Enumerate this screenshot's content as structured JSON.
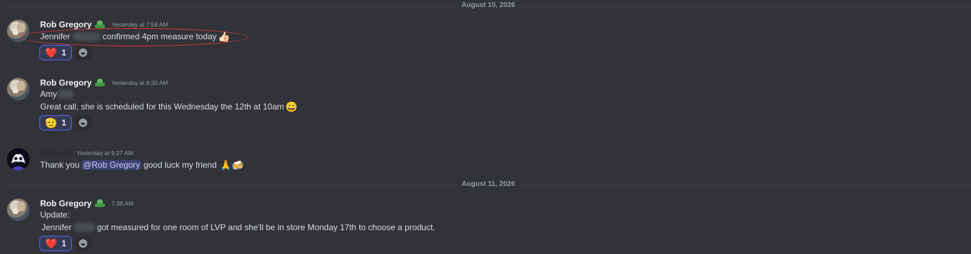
{
  "dividers": [
    "August 10, 2026",
    "August 11, 2026"
  ],
  "messages": [
    {
      "author": "Rob Gregory",
      "time": "Yesterday at 7:58 AM",
      "lines": [
        {
          "pre": "Jennifer",
          "post": "confirmed 4pm measure today",
          "emoji": "👍🏻"
        }
      ],
      "reaction": {
        "emoji": "❤️",
        "count": "1"
      }
    },
    {
      "author": "Rob Gregory",
      "time": "Yesterday at 8:30 AM",
      "lines": [
        {
          "pre": "Amy"
        },
        {
          "text": "Great call, she is scheduled for this Wednesday the 12th at 10am",
          "emoji": "😀"
        }
      ],
      "reaction": {
        "emoji": "🫡",
        "count": "1"
      }
    },
    {
      "author": "Soroush",
      "time": "Yesterday at 9:37 AM",
      "lines": [
        {
          "pre": "Thank you",
          "mention": "@Rob Gregory",
          "post": "good luck my friend",
          "emoji": "🙏🍻"
        }
      ]
    },
    {
      "author": "Rob Gregory",
      "time": "7:38 AM",
      "lines": [
        {
          "text": "Update:"
        },
        {
          "pre": "Jennifer",
          "post": "got measured for one room of LVP and she'll be in store Monday 17th to choose a product."
        }
      ],
      "reaction": {
        "emoji": "❤️",
        "count": "1"
      }
    }
  ],
  "colors": {
    "background": "#313338",
    "highlight_circle": "#e0383e",
    "reaction_border": "#5865f2",
    "mention_text": "#c9cdfb"
  },
  "icons": {
    "role_badge": "green-leaf-badge-icon",
    "add_reaction": "add-reaction-icon"
  }
}
